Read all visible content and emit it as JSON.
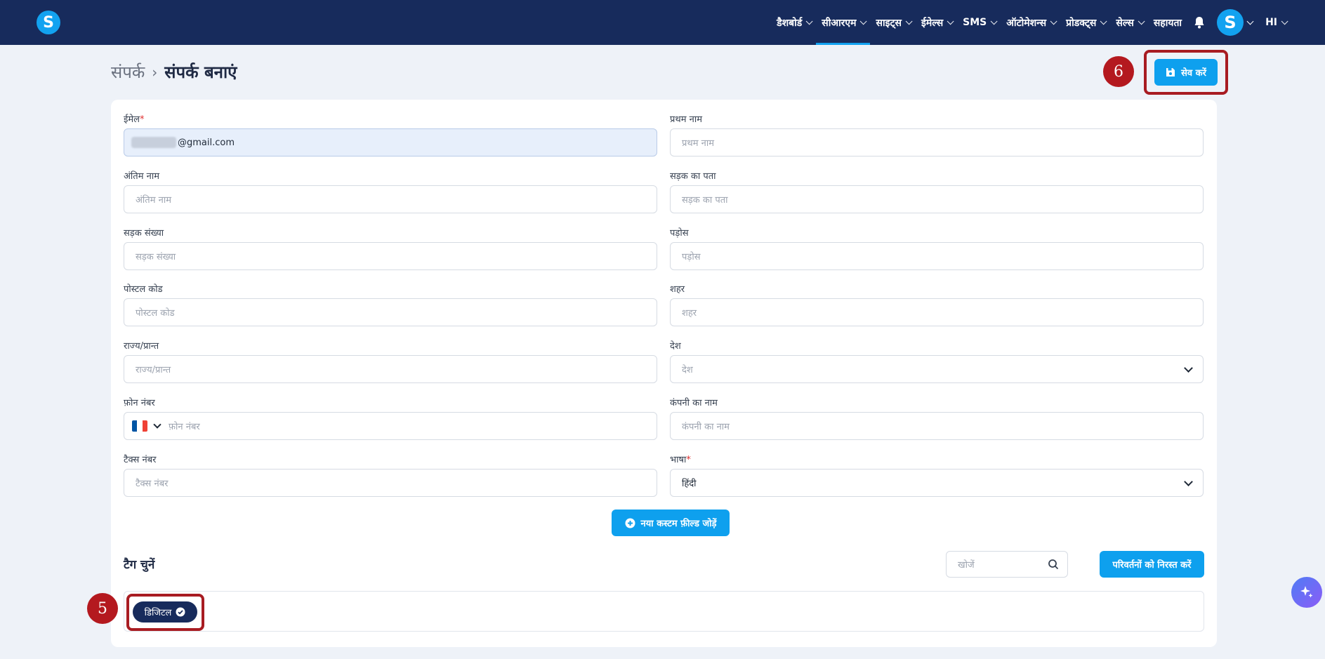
{
  "app": {
    "logo_letter": "S"
  },
  "nav": {
    "items": [
      {
        "label": "डैशबोर्ड",
        "active": false
      },
      {
        "label": "सीआरएम",
        "active": true
      },
      {
        "label": "साइट्स",
        "active": false
      },
      {
        "label": "ईमेल्स",
        "active": false
      },
      {
        "label": "SMS",
        "active": false
      },
      {
        "label": "ऑटोमेशन्स",
        "active": false
      },
      {
        "label": "प्रोडक्ट्स",
        "active": false
      },
      {
        "label": "सेल्स",
        "active": false
      }
    ],
    "help_label": "सहायता",
    "avatar_letter": "S",
    "language": "HI"
  },
  "breadcrumb": {
    "parent": "संपर्क",
    "separator": "›",
    "current": "संपर्क बनाएं"
  },
  "save_button": {
    "label": "सेव करें"
  },
  "annotations": {
    "save_step": "6",
    "tag_step": "5"
  },
  "form": {
    "email": {
      "label": "ईमेल",
      "required_mark": "*",
      "value_suffix": "@gmail.com"
    },
    "first_name": {
      "label": "प्रथम नाम",
      "placeholder": "प्रथम नाम"
    },
    "last_name": {
      "label": "अंतिम नाम",
      "placeholder": "अंतिम नाम"
    },
    "street_address": {
      "label": "सड़क का पता",
      "placeholder": "सड़क का पता"
    },
    "street_number": {
      "label": "सड़क संख्या",
      "placeholder": "सड़क संख्या"
    },
    "neighborhood": {
      "label": "पड़ोस",
      "placeholder": "पड़ोस"
    },
    "postal_code": {
      "label": "पोस्टल कोड",
      "placeholder": "पोस्टल कोड"
    },
    "city": {
      "label": "शहर",
      "placeholder": "शहर"
    },
    "state": {
      "label": "राज्य/प्रान्त",
      "placeholder": "राज्य/प्रान्त"
    },
    "country": {
      "label": "देश",
      "placeholder": "देश"
    },
    "phone": {
      "label": "फ़ोन नंबर",
      "placeholder": "फ़ोन नंबर",
      "flag_colors": [
        "#0055a4",
        "#ffffff",
        "#ef4135"
      ]
    },
    "company": {
      "label": "कंपनी का नाम",
      "placeholder": "कंपनी का नाम"
    },
    "tax_number": {
      "label": "टैक्स नंबर",
      "placeholder": "टैक्स नंबर"
    },
    "language": {
      "label": "भाषा",
      "required_mark": "*",
      "value": "हिंदी"
    }
  },
  "custom_field_button": {
    "label": "नया कस्टम फ़ील्ड जोड़ें"
  },
  "tags": {
    "title": "टैग चुनें",
    "search_placeholder": "खोजें",
    "discard_label": "परिवर्तनों को निरस्त करें",
    "selected": [
      {
        "label": "डिजिटल"
      }
    ]
  },
  "colors": {
    "nav_bg": "#172b5c",
    "accent": "#0ea0ee",
    "highlight": "#a81c22"
  }
}
